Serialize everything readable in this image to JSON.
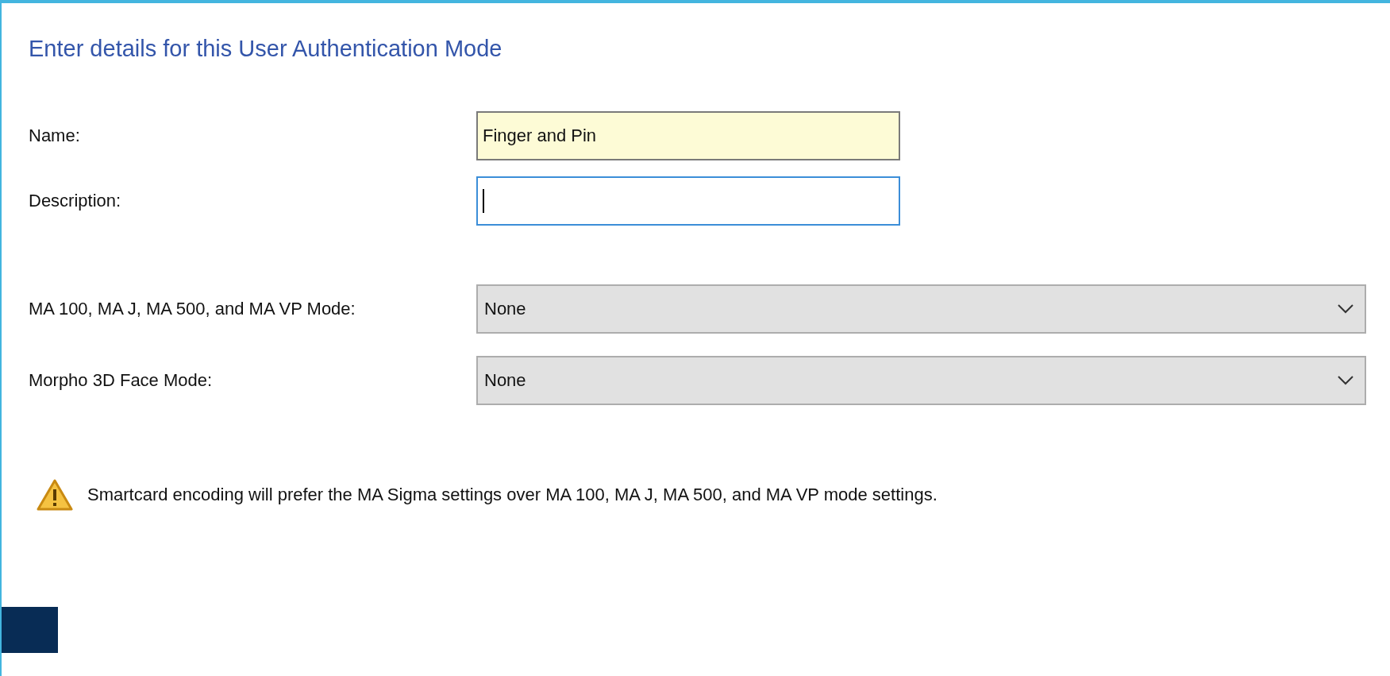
{
  "heading": "Enter details for this User Authentication Mode",
  "fields": [
    {
      "kind": "text",
      "label": "Name:",
      "value": "Finger and Pin",
      "focused": false
    },
    {
      "kind": "text",
      "label": "Description:",
      "focused": true
    },
    {
      "kind": "select",
      "label": "MA 100, MA J, MA 500, and MA VP Mode:",
      "value": "None"
    },
    {
      "kind": "select",
      "label": "Morpho 3D Face Mode:",
      "value": "None"
    }
  ],
  "warning": "Smartcard encoding will prefer the MA Sigma settings over MA 100, MA J, MA 500, and MA VP mode settings."
}
